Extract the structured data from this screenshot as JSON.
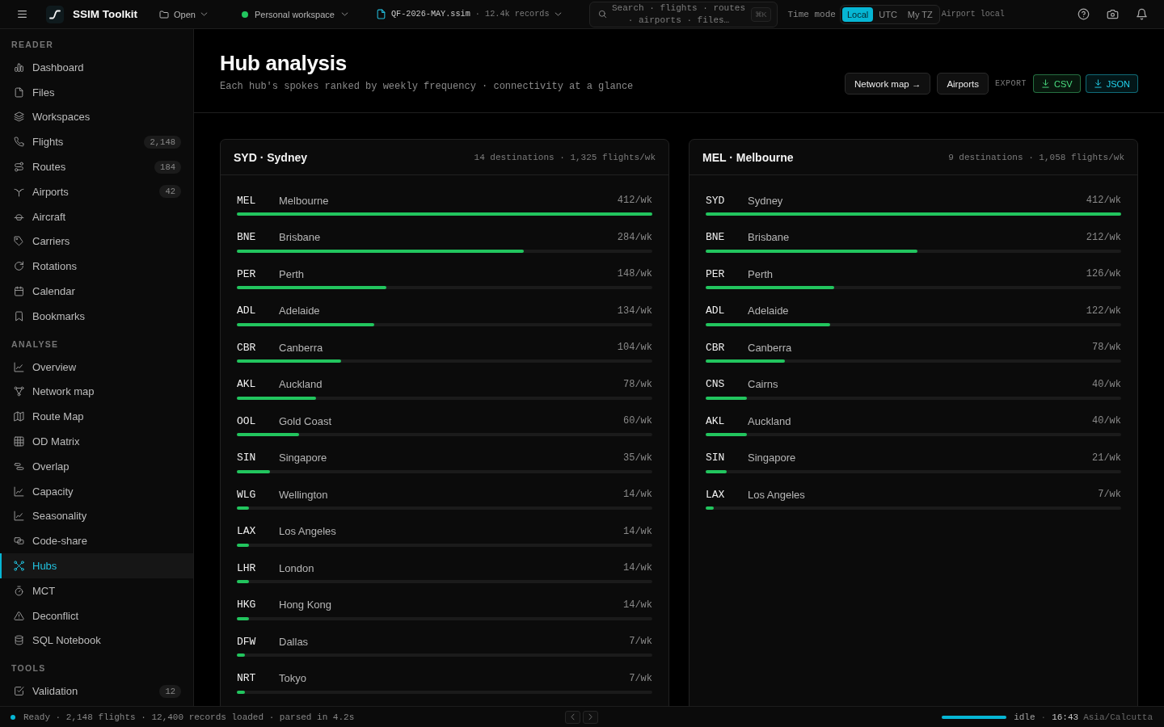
{
  "topbar": {
    "app_name": "SSIM Toolkit",
    "open": "Open",
    "workspace": "Personal workspace",
    "file": {
      "name": "QF-2026-MAY.ssim",
      "details": "· 12.4k records"
    },
    "search": {
      "placeholder": "Search · flights · routes · airports · files…",
      "shortcut": "⌘K"
    },
    "time_mode": {
      "label": "Time mode",
      "options": [
        {
          "label": "Local",
          "selected": true
        },
        {
          "label": "UTC",
          "selected": false
        },
        {
          "label": "My TZ",
          "selected": false
        }
      ],
      "note": "Airport local"
    }
  },
  "sidebar": {
    "sections": [
      {
        "title": "READER",
        "items": [
          {
            "label": "Dashboard",
            "selected": false
          },
          {
            "label": "Files",
            "selected": false
          },
          {
            "label": "Workspaces",
            "selected": false
          },
          {
            "label": "Flights",
            "badge": "2,148",
            "selected": false
          },
          {
            "label": "Routes",
            "badge": "184",
            "selected": false
          },
          {
            "label": "Airports",
            "badge": "42",
            "selected": false
          },
          {
            "label": "Aircraft",
            "selected": false
          },
          {
            "label": "Carriers",
            "selected": false
          },
          {
            "label": "Rotations",
            "selected": false
          },
          {
            "label": "Calendar",
            "selected": false
          },
          {
            "label": "Bookmarks",
            "selected": false
          }
        ]
      },
      {
        "title": "ANALYSE",
        "items": [
          {
            "label": "Overview",
            "selected": false
          },
          {
            "label": "Network map",
            "selected": false
          },
          {
            "label": "Route Map",
            "selected": false
          },
          {
            "label": "OD Matrix",
            "selected": false
          },
          {
            "label": "Overlap",
            "selected": false
          },
          {
            "label": "Capacity",
            "selected": false
          },
          {
            "label": "Seasonality",
            "selected": false
          },
          {
            "label": "Code-share",
            "selected": false
          },
          {
            "label": "Hubs",
            "selected": true
          },
          {
            "label": "MCT",
            "selected": false
          },
          {
            "label": "Deconflict",
            "selected": false
          },
          {
            "label": "SQL Notebook",
            "selected": false
          }
        ]
      },
      {
        "title": "TOOLS",
        "items": [
          {
            "label": "Validation",
            "badge": "12",
            "selected": false
          }
        ]
      }
    ]
  },
  "header": {
    "title": "Hub analysis",
    "subtitle": "Each hub's spokes ranked by weekly frequency · connectivity at a glance",
    "buttons": [
      "Network map →",
      "Airports"
    ],
    "export_label": "EXPORT",
    "export_buttons": [
      {
        "label": "CSV",
        "color": "#4ade80"
      },
      {
        "label": "JSON",
        "color": "#22d3ee"
      }
    ]
  },
  "hubs": [
    {
      "title": "SYD · Sydney",
      "summary": "14 destinations · 1,325 flights/wk",
      "spokes": [
        {
          "code": "MEL",
          "city": "Melbourne",
          "frequency": "412/wk",
          "level": 1
        },
        {
          "code": "BNE",
          "city": "Brisbane",
          "frequency": "284/wk",
          "level": 0.69
        },
        {
          "code": "PER",
          "city": "Perth",
          "frequency": "148/wk",
          "level": 0.36
        },
        {
          "code": "ADL",
          "city": "Adelaide",
          "frequency": "134/wk",
          "level": 0.33
        },
        {
          "code": "CBR",
          "city": "Canberra",
          "frequency": "104/wk",
          "level": 0.25
        },
        {
          "code": "AKL",
          "city": "Auckland",
          "frequency": "78/wk",
          "level": 0.19
        },
        {
          "code": "OOL",
          "city": "Gold Coast",
          "frequency": "60/wk",
          "level": 0.15
        },
        {
          "code": "SIN",
          "city": "Singapore",
          "frequency": "35/wk",
          "level": 0.08
        },
        {
          "code": "WLG",
          "city": "Wellington",
          "frequency": "14/wk",
          "level": 0.03
        },
        {
          "code": "LAX",
          "city": "Los Angeles",
          "frequency": "14/wk",
          "level": 0.03
        },
        {
          "code": "LHR",
          "city": "London",
          "frequency": "14/wk",
          "level": 0.03
        },
        {
          "code": "HKG",
          "city": "Hong Kong",
          "frequency": "14/wk",
          "level": 0.03
        },
        {
          "code": "DFW",
          "city": "Dallas",
          "frequency": "7/wk",
          "level": 0.02
        },
        {
          "code": "NRT",
          "city": "Tokyo",
          "frequency": "7/wk",
          "level": 0.02
        }
      ]
    },
    {
      "title": "MEL · Melbourne",
      "summary": "9 destinations · 1,058 flights/wk",
      "spokes": [
        {
          "code": "SYD",
          "city": "Sydney",
          "frequency": "412/wk",
          "level": 1
        },
        {
          "code": "BNE",
          "city": "Brisbane",
          "frequency": "212/wk",
          "level": 0.51
        },
        {
          "code": "PER",
          "city": "Perth",
          "frequency": "126/wk",
          "level": 0.31
        },
        {
          "code": "ADL",
          "city": "Adelaide",
          "frequency": "122/wk",
          "level": 0.3
        },
        {
          "code": "CBR",
          "city": "Canberra",
          "frequency": "78/wk",
          "level": 0.19
        },
        {
          "code": "CNS",
          "city": "Cairns",
          "frequency": "40/wk",
          "level": 0.1
        },
        {
          "code": "AKL",
          "city": "Auckland",
          "frequency": "40/wk",
          "level": 0.1
        },
        {
          "code": "SIN",
          "city": "Singapore",
          "frequency": "21/wk",
          "level": 0.05
        },
        {
          "code": "LAX",
          "city": "Los Angeles",
          "frequency": "7/wk",
          "level": 0.02
        }
      ]
    }
  ],
  "status_bar": {
    "status": "Ready · 2,148 flights · 12,400 records loaded · parsed in 4.2s",
    "progress": {
      "level": 1
    },
    "activity": "idle",
    "separator": "·",
    "time": "16:43",
    "timezone": "Asia/Calcutta"
  }
}
